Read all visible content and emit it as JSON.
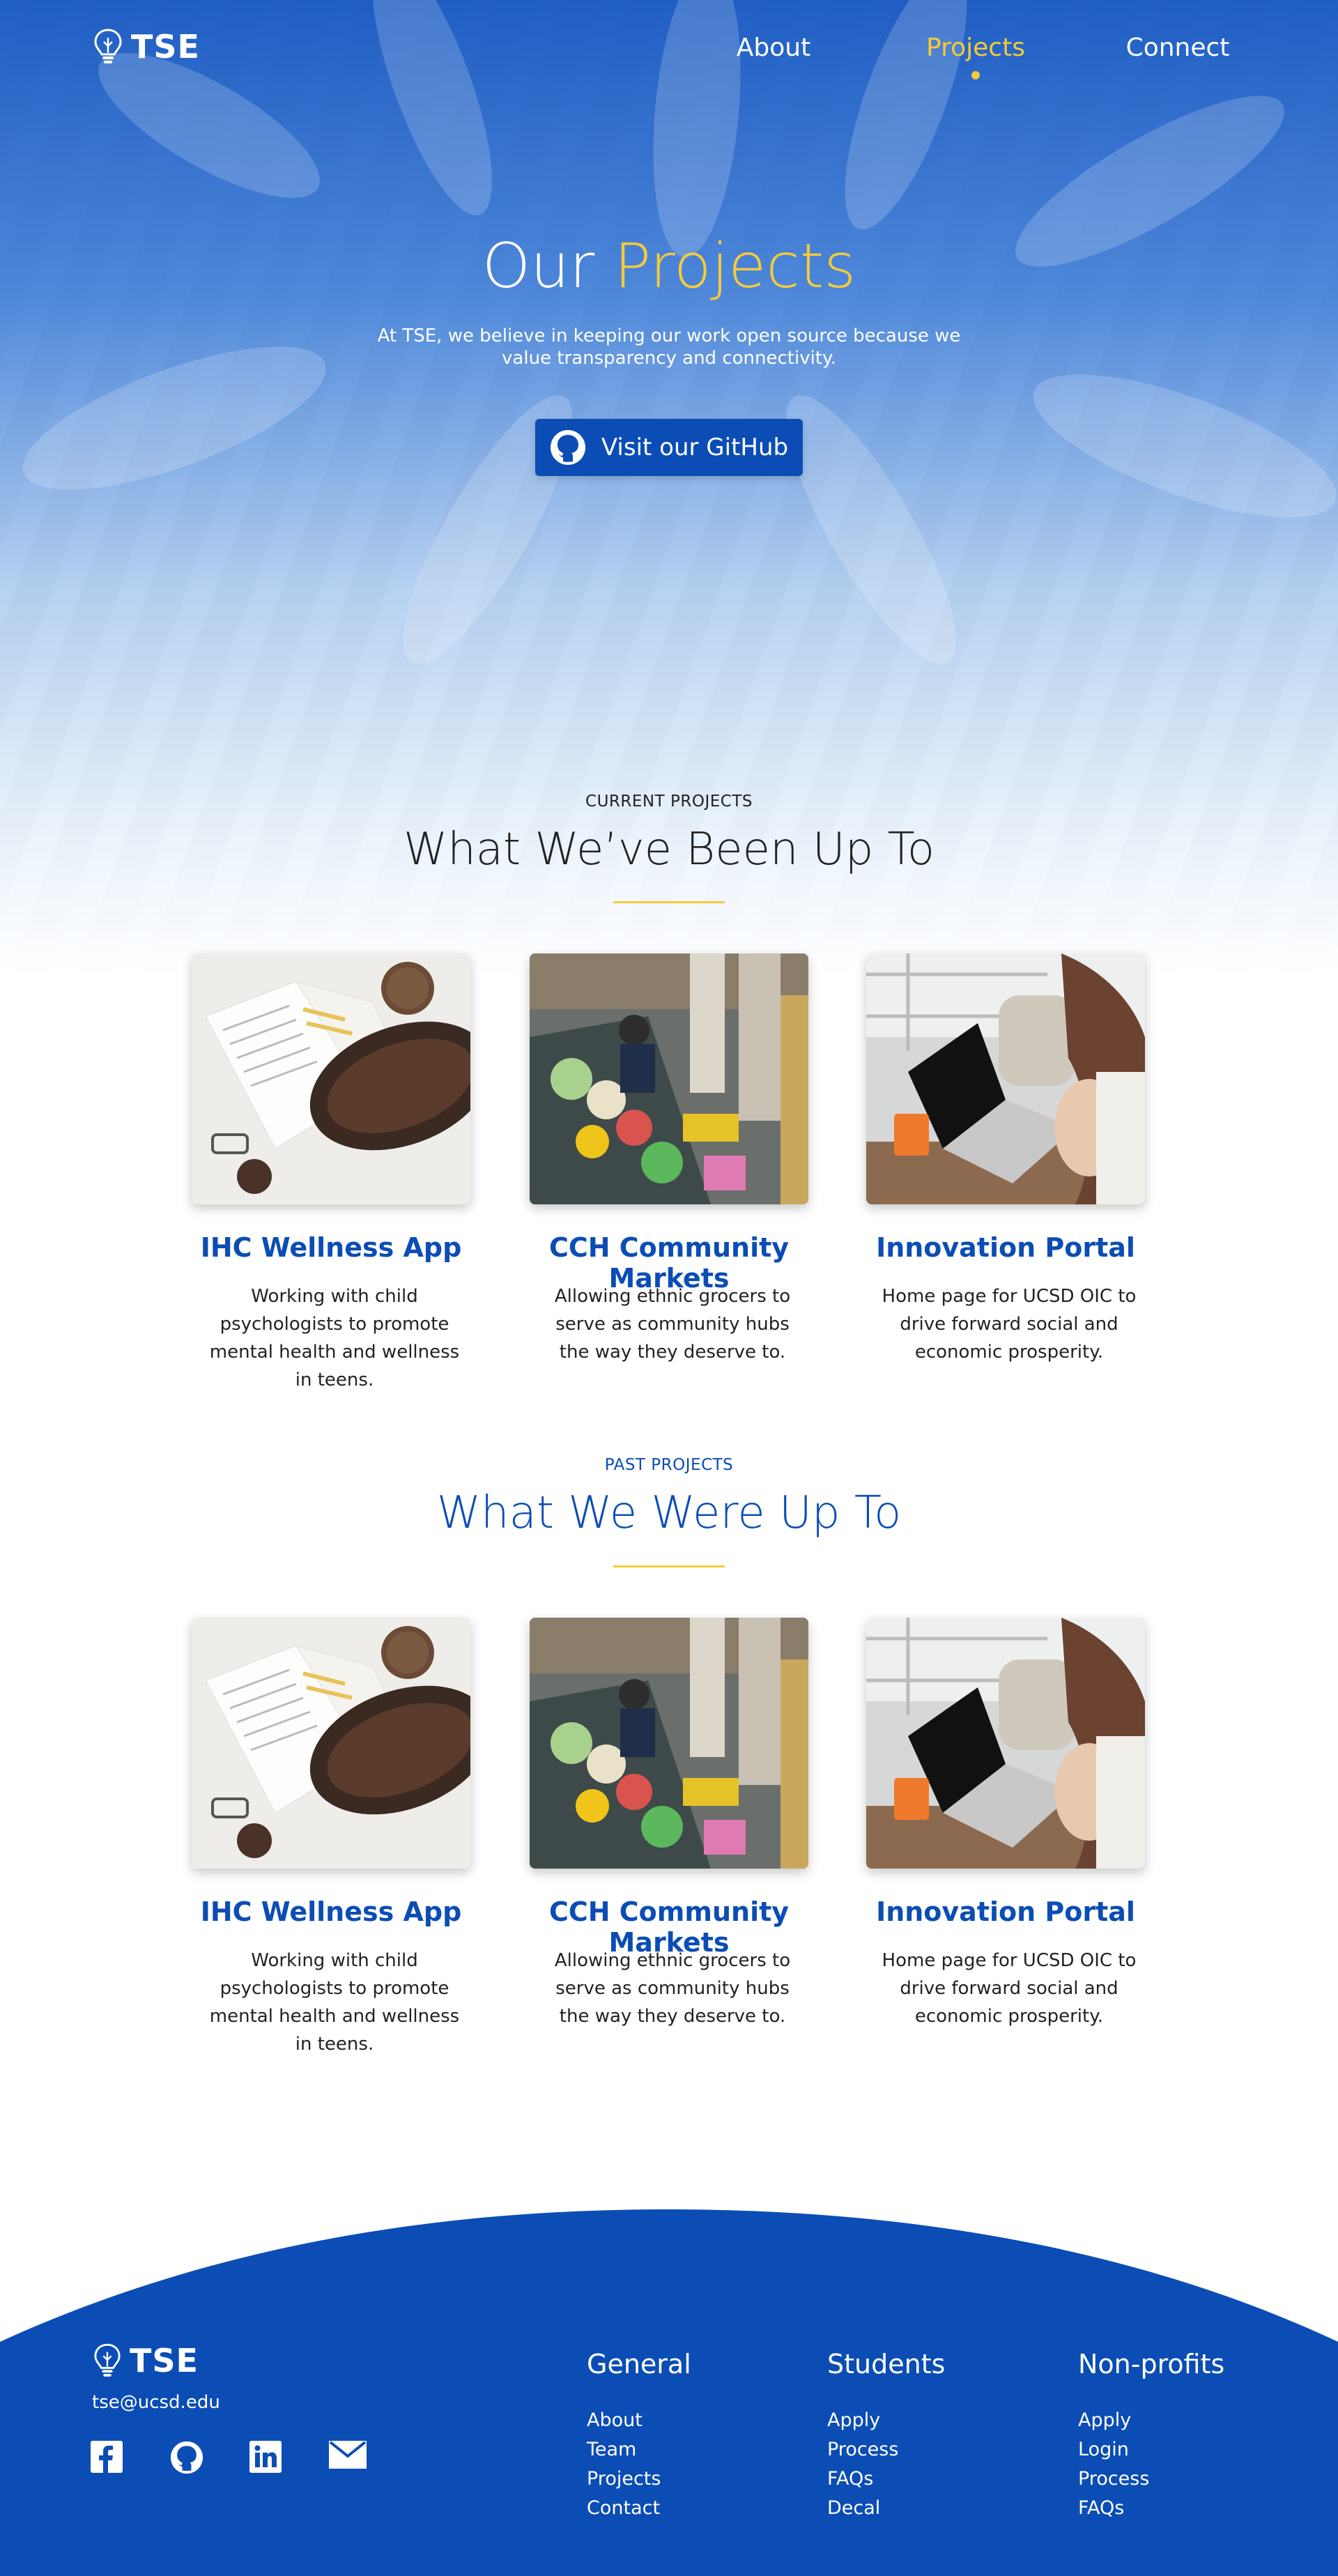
{
  "brand": {
    "name": "TSE",
    "accent": "#f5cb3a",
    "primary": "#0b4db5"
  },
  "nav": {
    "links": [
      {
        "label": "About"
      },
      {
        "label": "Projects"
      },
      {
        "label": "Connect"
      }
    ],
    "active": "Projects"
  },
  "hero": {
    "title_plain": "Our",
    "title_accent": "Projects",
    "subtitle": "At TSE, we believe in keeping our work open source because we value transparency and connectivity.",
    "button_label": "Visit our GitHub",
    "button_icon": "github-icon"
  },
  "current": {
    "kicker": "CURRENT PROJECTS",
    "title": "What We’ve Been Up To",
    "cards": [
      {
        "title": "IHC Wellness App",
        "description": "Working with child psychologists to promote mental health and wellness in teens.",
        "image": "book-and-knitting-photo"
      },
      {
        "title": "CCH Community Markets",
        "description": "Allowing ethnic grocers to serve as community hubs the way they deserve to.",
        "image": "floating-market-photo"
      },
      {
        "title": "Innovation Portal",
        "description": "Home page for UCSD OIC to drive forward social and economic prosperity.",
        "image": "laptop-user-photo"
      }
    ]
  },
  "past": {
    "kicker": "PAST PROJECTS",
    "title": "What We Were Up To",
    "cards": [
      {
        "title": "IHC Wellness App",
        "description": "Working with child psychologists to promote mental health and wellness in teens.",
        "image": "book-and-knitting-photo"
      },
      {
        "title": "CCH Community Markets",
        "description": "Allowing ethnic grocers to serve as community hubs the way they deserve to.",
        "image": "floating-market-photo"
      },
      {
        "title": "Innovation Portal",
        "description": "Home page for UCSD OIC to drive forward social and economic prosperity.",
        "image": "laptop-user-photo"
      }
    ]
  },
  "footer": {
    "brand": "TSE",
    "email": "tse@ucsd.edu",
    "social": [
      "facebook-icon",
      "github-icon",
      "linkedin-icon",
      "mail-icon"
    ],
    "columns": [
      {
        "heading": "General",
        "links": [
          "About",
          "Team",
          "Projects",
          "Contact"
        ]
      },
      {
        "heading": "Students",
        "links": [
          "Apply",
          "Process",
          "FAQs",
          "Decal"
        ]
      },
      {
        "heading": "Non-profits",
        "links": [
          "Apply",
          "Login",
          "Process",
          "FAQs"
        ]
      }
    ]
  }
}
